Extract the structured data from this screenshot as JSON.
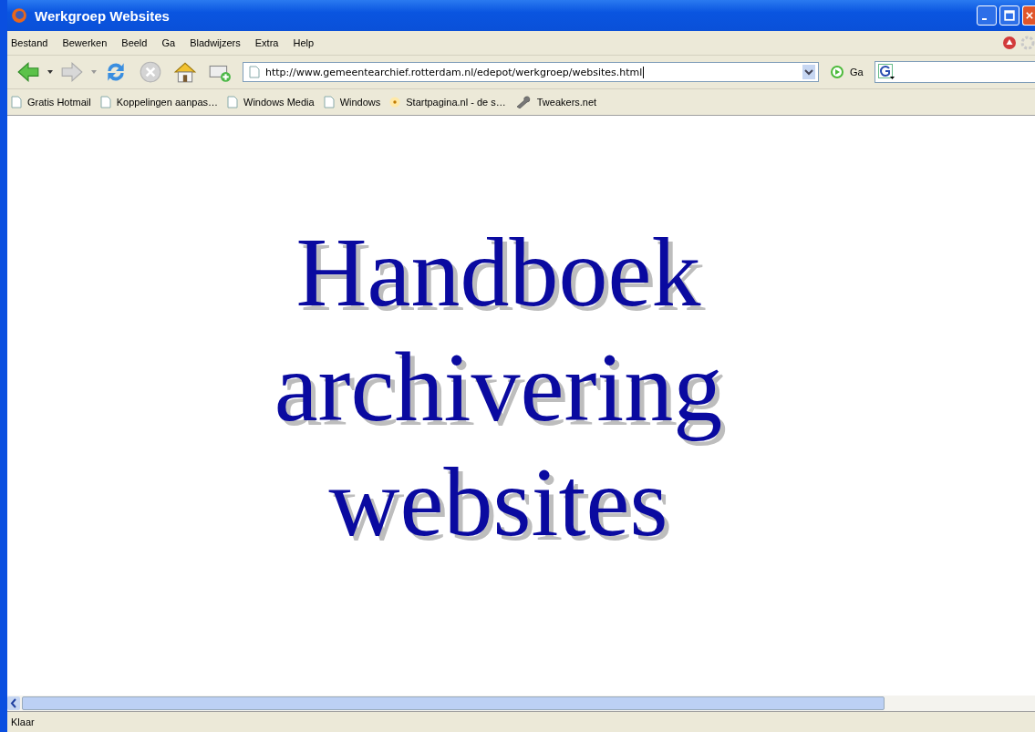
{
  "window": {
    "title": "Werkgroep Websites"
  },
  "menu": [
    "Bestand",
    "Bewerken",
    "Beeld",
    "Ga",
    "Bladwijzers",
    "Extra",
    "Help"
  ],
  "address": {
    "value": "http://www.gemeentearchief.rotterdam.nl/edepot/werkgroep/websites.html",
    "go_label": "Ga"
  },
  "bookmarks": [
    {
      "label": "Gratis Hotmail",
      "kind": "page"
    },
    {
      "label": "Koppelingen aanpas…",
      "kind": "page"
    },
    {
      "label": "Windows Media",
      "kind": "page"
    },
    {
      "label": "Windows",
      "kind": "page"
    },
    {
      "label": "Startpagina.nl - de s…",
      "kind": "startpagina"
    },
    {
      "label": "Tweakers.net",
      "kind": "wrench"
    }
  ],
  "content": {
    "heading": [
      "Handboek",
      "archivering",
      "websites"
    ]
  },
  "status_bar": "Klaar"
}
